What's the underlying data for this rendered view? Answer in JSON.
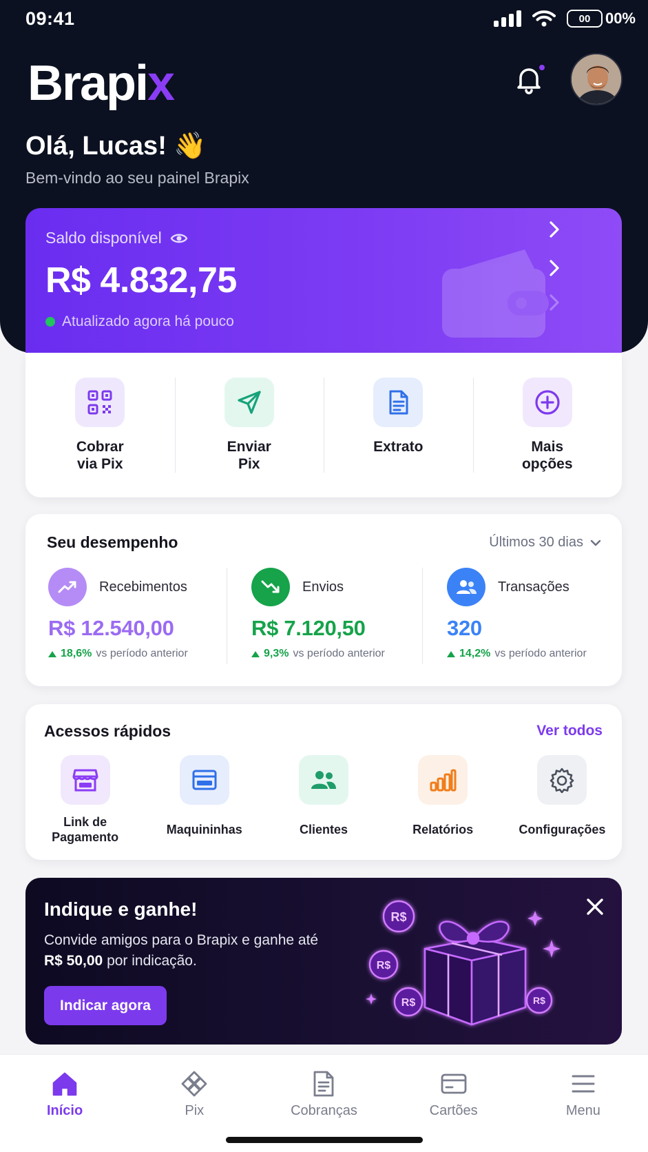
{
  "status_bar": {
    "time": "09:41",
    "battery_label": "00",
    "battery_text": "00%"
  },
  "header": {
    "logo_main": "Brapi",
    "logo_accent": "x",
    "greeting": "Olá, Lucas! 👋",
    "subtitle": "Bem-vindo ao seu painel Brapix"
  },
  "balance": {
    "label": "Saldo disponível",
    "value": "R$ 4.832,75",
    "updated": "Atualizado agora há pouco"
  },
  "quick_actions": [
    {
      "label": "Cobrar\nvia Pix",
      "icon": "qr-code-icon"
    },
    {
      "label": "Enviar\nPix",
      "icon": "send-icon"
    },
    {
      "label": "Extrato",
      "icon": "document-icon"
    },
    {
      "label": "Mais\nopções",
      "icon": "plus-circle-icon"
    }
  ],
  "performance": {
    "title": "Seu desempenho",
    "period": "Últimos 30 dias",
    "metrics": [
      {
        "name": "Recebimentos",
        "value": "R$ 12.540,00",
        "change": "18,6%",
        "change_text": "vs período anterior",
        "color": "#9b6bf2"
      },
      {
        "name": "Envios",
        "value": "R$ 7.120,50",
        "change": "9,3%",
        "change_text": "vs período anterior",
        "color": "#16a34a"
      },
      {
        "name": "Transações",
        "value": "320",
        "change": "14,2%",
        "change_text": "vs período anterior",
        "color": "#3b82f6"
      }
    ]
  },
  "quick_access": {
    "title": "Acessos rápidos",
    "see_all": "Ver todos",
    "items": [
      {
        "label": "Link de\nPagamento",
        "icon": "storefront-icon"
      },
      {
        "label": "Maquininhas",
        "icon": "card-machine-icon"
      },
      {
        "label": "Clientes",
        "icon": "users-icon"
      },
      {
        "label": "Relatórios",
        "icon": "bar-chart-icon"
      },
      {
        "label": "Configurações",
        "icon": "gear-icon"
      }
    ]
  },
  "promo": {
    "title": "Indique e ganhe!",
    "text_before": "Convide amigos para o Brapix e ganhe até ",
    "text_bold": "R$ 50,00",
    "text_after": " por indicação.",
    "button": "Indicar agora",
    "coin_label": "R$"
  },
  "bottom_nav": [
    {
      "label": "Início",
      "active": true
    },
    {
      "label": "Pix",
      "active": false
    },
    {
      "label": "Cobranças",
      "active": false
    },
    {
      "label": "Cartões",
      "active": false
    },
    {
      "label": "Menu",
      "active": false
    }
  ],
  "colors": {
    "accent": "#7c3aed",
    "dark": "#0b1120",
    "positive": "#16a34a"
  }
}
